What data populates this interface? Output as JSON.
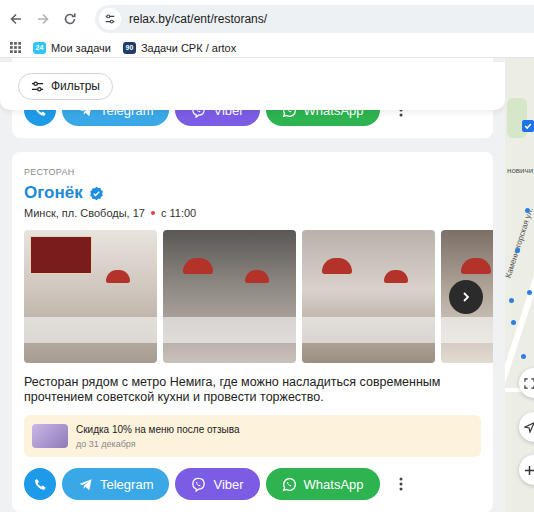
{
  "browser": {
    "url": "relax.by/cat/ent/restorans/",
    "bookmarks": [
      {
        "label": "Мои задачи",
        "favicon_text": "24",
        "color": "#2fc6f6"
      },
      {
        "label": "Задачи СРК / artox",
        "favicon_text": "90",
        "color": "#1d3d6b"
      }
    ]
  },
  "filter_button": {
    "label": "Фильтры"
  },
  "previous_card": {
    "contacts": [
      {
        "kind": "phone",
        "color": "#1e9be8"
      },
      {
        "kind": "telegram",
        "label": "Telegram",
        "color": "#3aa8e6"
      },
      {
        "kind": "viber",
        "label": "Viber",
        "color": "#7b5ce5"
      },
      {
        "kind": "whatsapp",
        "label": "WhatsApp",
        "color": "#2db34f"
      },
      {
        "kind": "more",
        "color": "#ffffff"
      }
    ]
  },
  "card": {
    "category": "РЕСТОРАН",
    "title": "Огонёк",
    "verified": true,
    "address": "Минск, пл. Свободы, 17",
    "hours": "с 11:00",
    "photo_count": 4,
    "description": "Ресторан рядом с метро Немига, где можно насладиться современным прочтением советской кухни и провести торжество.",
    "promo": {
      "title": "Скидка 10% на меню после отзыва",
      "until": "до 31 декабря"
    },
    "contacts": [
      {
        "kind": "phone",
        "color": "#1e9be8"
      },
      {
        "kind": "telegram",
        "label": "Telegram",
        "color": "#3aa8e6"
      },
      {
        "kind": "viber",
        "label": "Viber",
        "color": "#7b5ce5"
      },
      {
        "kind": "whatsapp",
        "label": "WhatsApp",
        "color": "#2db34f"
      },
      {
        "kind": "more",
        "color": "#ffffff"
      }
    ]
  },
  "map": {
    "labels": [
      {
        "text": "новичи"
      },
      {
        "text": "Каменногорская ул."
      }
    ]
  }
}
